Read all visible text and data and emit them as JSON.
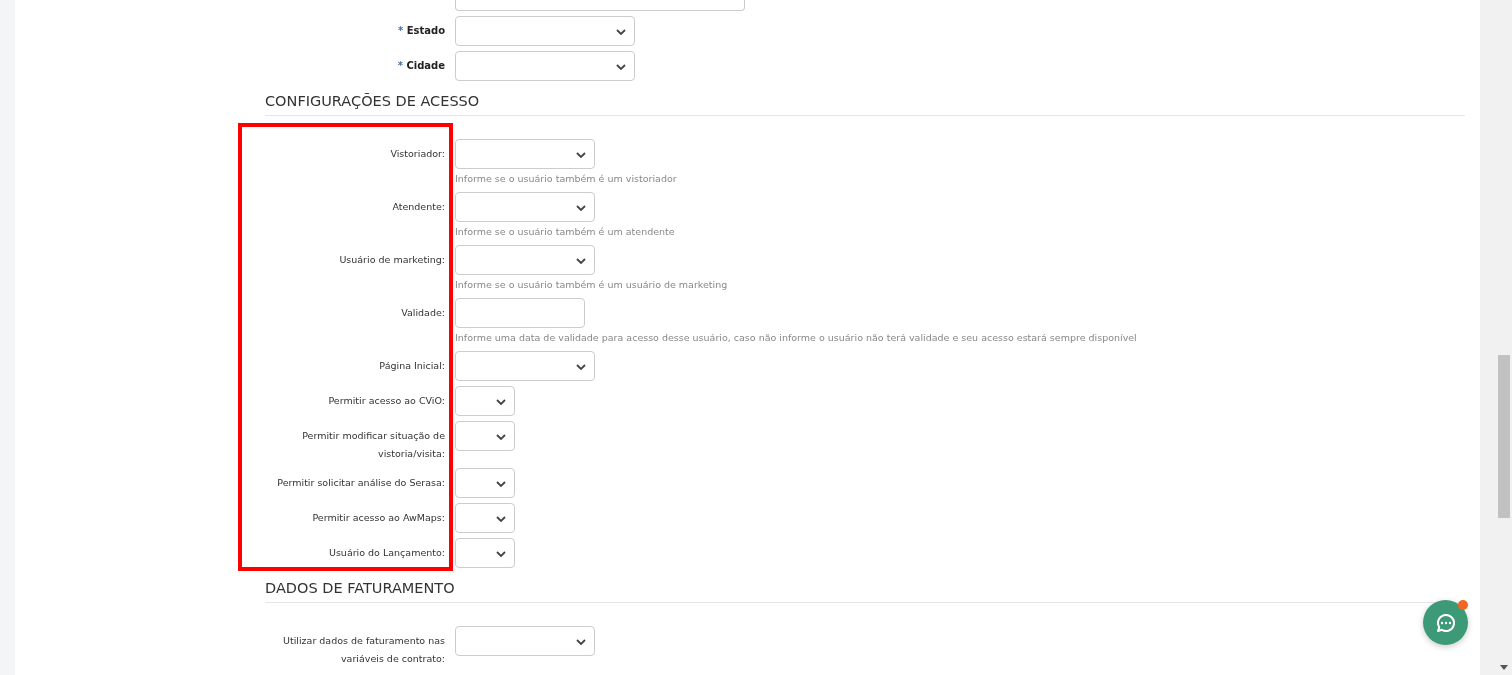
{
  "address_fields": [
    {
      "marker": "*",
      "label": "Estado",
      "kind": "select"
    },
    {
      "marker": "*",
      "label": "Cidade",
      "kind": "select"
    }
  ],
  "sections": [
    {
      "title": "CONFIGURAÇÕES DE ACESSO",
      "highlighted": true,
      "fields": [
        {
          "label": "Vistoriador:",
          "kind": "select",
          "hint": "Informe se o usuário também é um vistoriador"
        },
        {
          "label": "Atendente:",
          "kind": "select",
          "hint": "Informe se o usuário também é um atendente"
        },
        {
          "label": "Usuário de marketing:",
          "kind": "select",
          "hint": "Informe se o usuário também é um usuário de marketing"
        },
        {
          "label": "Validade:",
          "kind": "date",
          "hint": "Informe uma data de validade para acesso desse usuário, caso não informe o usuário não terá validade e seu acesso estará sempre disponível"
        },
        {
          "label": "Página Inicial:",
          "kind": "select"
        },
        {
          "label": "Permitir acesso ao CViO:",
          "kind": "toggle"
        },
        {
          "label": "Permitir modificar situação de vistoria/visita:",
          "kind": "toggle"
        },
        {
          "label": "Permitir solicitar análise do Serasa:",
          "kind": "toggle"
        },
        {
          "label": "Permitir acesso ao AwMaps:",
          "kind": "toggle"
        },
        {
          "label": "Usuário do Lançamento:",
          "kind": "toggle"
        }
      ]
    },
    {
      "title": "DADOS DE FATURAMENTO",
      "fields": [
        {
          "label": "Utilizar dados de faturamento nas variáveis de contrato:",
          "kind": "select"
        }
      ]
    }
  ],
  "chat": {
    "unread": true
  }
}
